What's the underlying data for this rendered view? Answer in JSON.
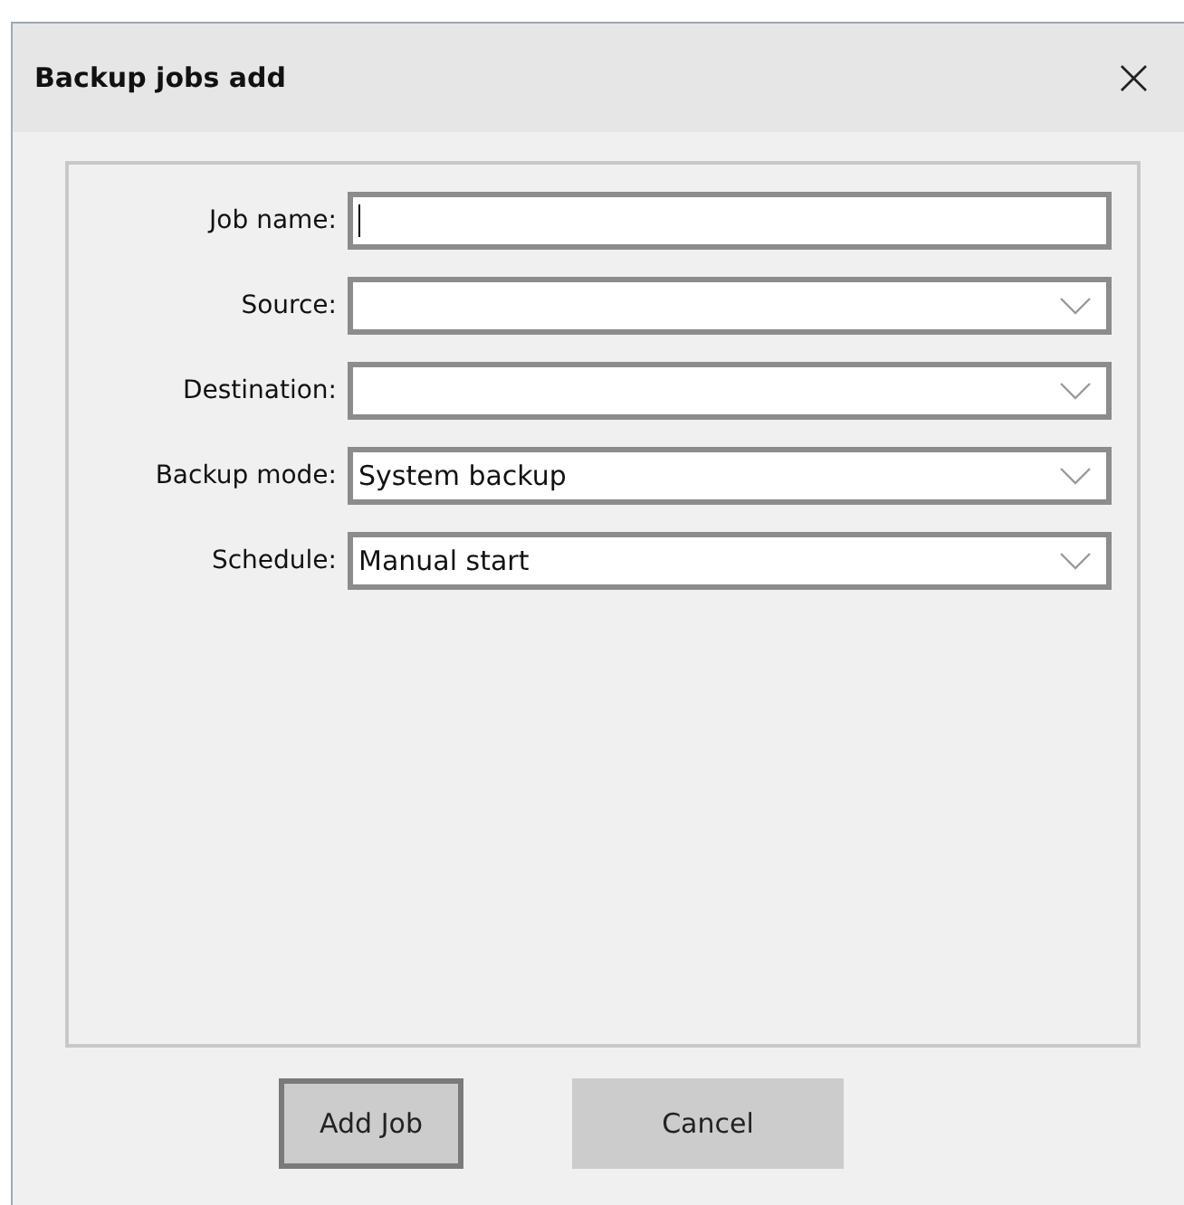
{
  "window": {
    "title": "Backup jobs add",
    "close": "×"
  },
  "fields": [
    {
      "label": "Job name:",
      "kind": "text",
      "focused": true
    },
    {
      "label": "Source:",
      "kind": "dropdown"
    },
    {
      "label": "Destination:",
      "kind": "dropdown"
    },
    {
      "label": "Backup mode:",
      "kind": "dropdown",
      "value": "System backup"
    },
    {
      "label": "Schedule:",
      "kind": "dropdown",
      "value": "Manual start"
    }
  ],
  "buttons": [
    {
      "label": "Add Job",
      "default": true
    },
    {
      "label": "Cancel",
      "default": false
    }
  ]
}
